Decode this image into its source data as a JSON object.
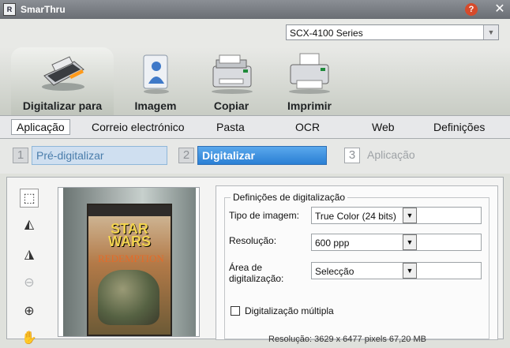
{
  "window": {
    "title": "SmarThru",
    "logo_text": "R",
    "help_icon": "help-icon",
    "close_icon": "close-icon"
  },
  "device": {
    "selected": "SCX-4100 Series"
  },
  "functions": [
    {
      "label": "Digitalizar para",
      "icon": "scanner-icon",
      "active": true
    },
    {
      "label": "Imagem",
      "icon": "image-person-icon"
    },
    {
      "label": "Copiar",
      "icon": "copier-icon"
    },
    {
      "label": "Imprimir",
      "icon": "printer-icon"
    }
  ],
  "subtabs": [
    "Aplicação",
    "Correio electrónico",
    "Pasta",
    "OCR",
    "Web",
    "Definições"
  ],
  "steps": [
    {
      "num": "1",
      "label": "Pré-digitalizar"
    },
    {
      "num": "2",
      "label": "Digitalizar"
    },
    {
      "num": "3",
      "label": "Aplicação"
    }
  ],
  "tools": [
    "select-area-icon",
    "flip-horizontal-icon",
    "flip-vertical-icon",
    "zoom-out-icon",
    "zoom-in-icon",
    "hand-icon"
  ],
  "preview": {
    "cover_title": "STAR WARS",
    "cover_sub": "REDEMPTION"
  },
  "settings": {
    "legend": "Definições de digitalização",
    "image_type_label": "Tipo de imagem:",
    "image_type_value": "True Color (24 bits)",
    "resolution_label": "Resolução:",
    "resolution_value": "600 ppp",
    "area_label_1": "Área de",
    "area_label_2": "digitalização:",
    "area_value": "Selecção",
    "multi_label": "Digitalização múltipla",
    "info_text": "Resolução: 3629 x 6477 pixels  67,20 MB"
  },
  "colors": {
    "accent": "#2a7fd4",
    "titlebar": "#7a7e84",
    "panel": "#dfe1dc"
  }
}
